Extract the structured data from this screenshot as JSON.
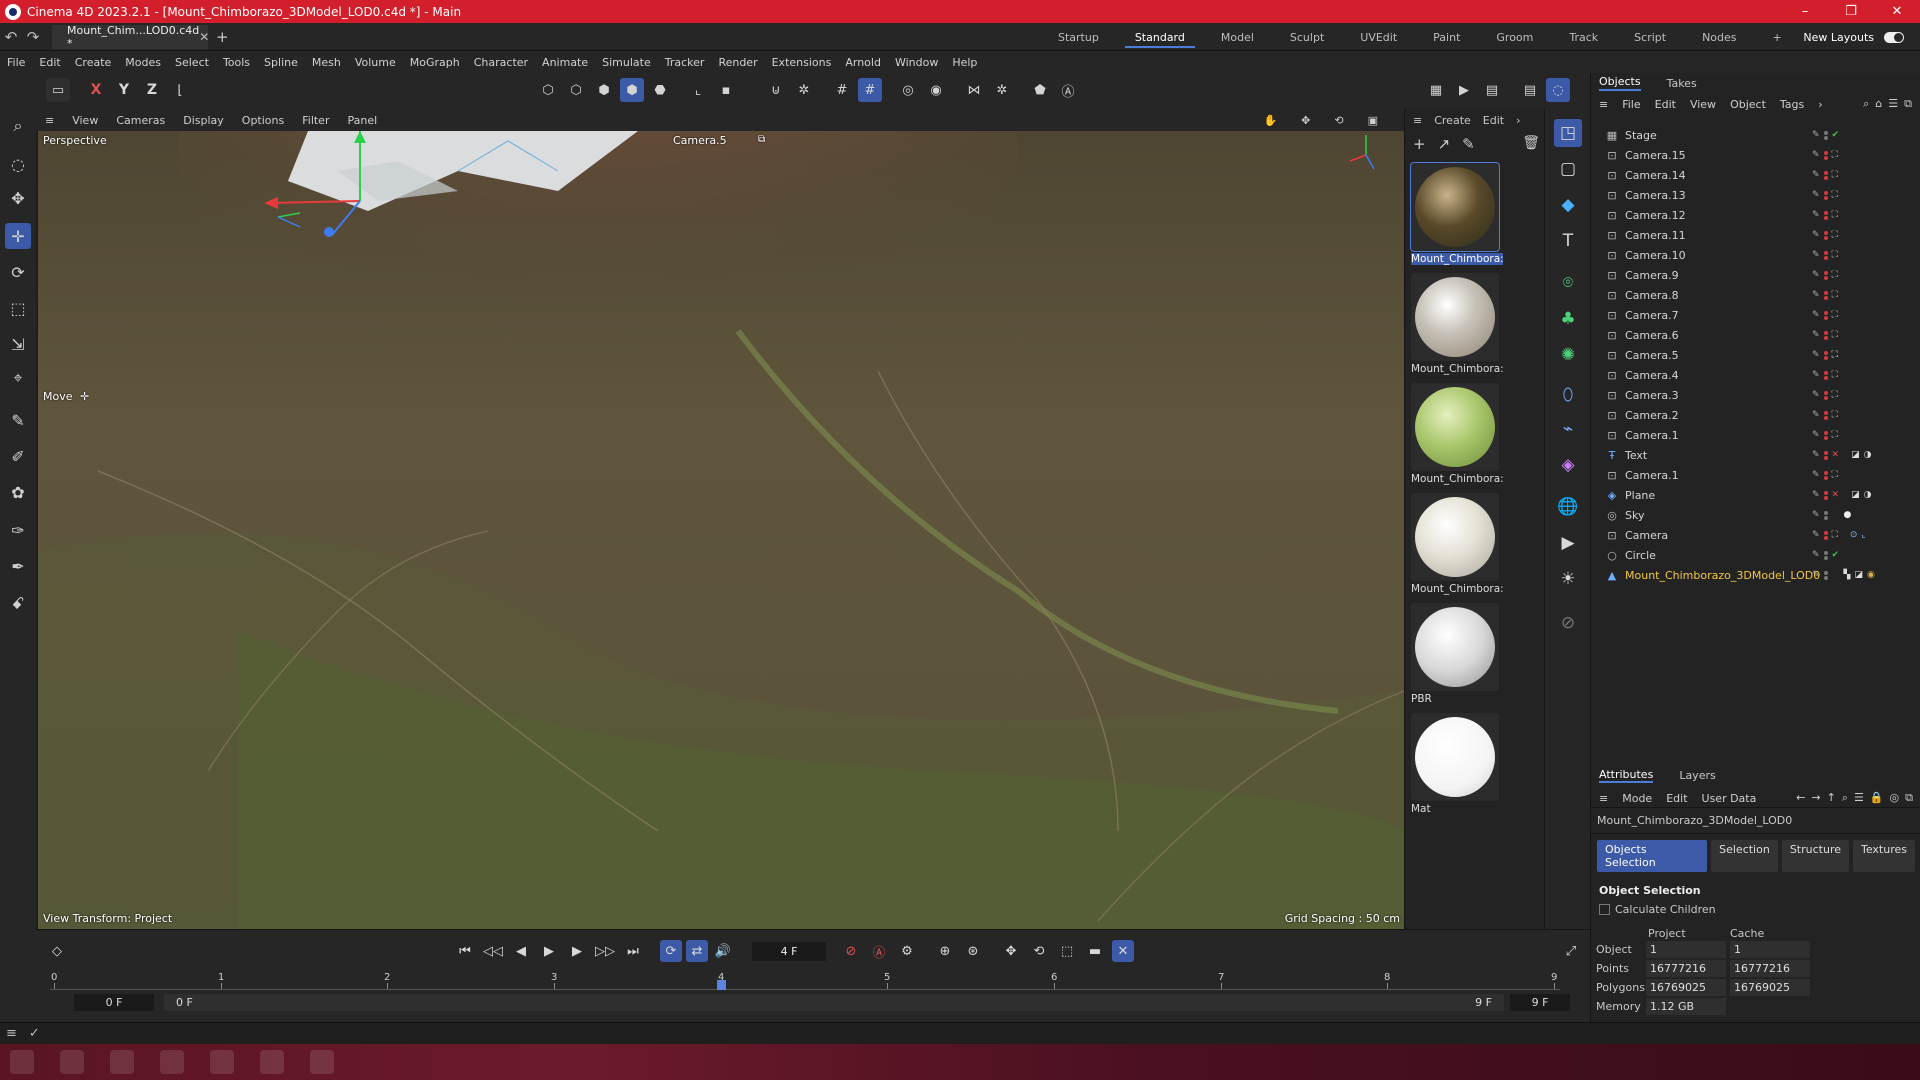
{
  "window": {
    "title": "Cinema 4D 2023.2.1 - [Mount_Chimborazo_3DModel_LOD0.c4d *] - Main",
    "min": "–",
    "max": "❐",
    "close": "✕"
  },
  "tabs": {
    "doc_tab": "Mount_Chim...LOD0.c4d *",
    "add": "+",
    "undo": "↶",
    "redo": "↷"
  },
  "layouts": [
    "Startup",
    "Standard",
    "Model",
    "Sculpt",
    "UVEdit",
    "Paint",
    "Groom",
    "Track",
    "Script",
    "Nodes"
  ],
  "layouts_add": "+",
  "new_layouts": "New Layouts",
  "menu": [
    "File",
    "Edit",
    "Create",
    "Modes",
    "Select",
    "Tools",
    "Spline",
    "Mesh",
    "Volume",
    "MoGraph",
    "Character",
    "Animate",
    "Simulate",
    "Tracker",
    "Render",
    "Extensions",
    "Arnold",
    "Window",
    "Help"
  ],
  "axis_toggles": {
    "x": "X",
    "y": "Y",
    "z": "Z"
  },
  "viewport": {
    "menu": [
      "View",
      "Cameras",
      "Display",
      "Options",
      "Filter",
      "Panel"
    ],
    "projection": "Perspective",
    "camera": "Camera.5",
    "tool": "Move",
    "view_transform": "View Transform: Project",
    "grid_spacing": "Grid Spacing : 50 cm"
  },
  "materials": {
    "menu": [
      "Create",
      "Edit"
    ],
    "items": [
      {
        "name": "Mount_Chimbora:"
      },
      {
        "name": "Mount_Chimbora:"
      },
      {
        "name": "Mount_Chimbora:"
      },
      {
        "name": "Mount_Chimbora:"
      },
      {
        "name": "PBR"
      },
      {
        "name": "Mat"
      }
    ]
  },
  "objects_panel": {
    "tabs": [
      "Objects",
      "Takes"
    ],
    "menu": [
      "File",
      "Edit",
      "View",
      "Object",
      "Tags"
    ],
    "items": [
      {
        "name": "Stage",
        "icon": "stage-icon"
      },
      {
        "name": "Camera.15",
        "icon": "camera-icon"
      },
      {
        "name": "Camera.14",
        "icon": "camera-icon"
      },
      {
        "name": "Camera.13",
        "icon": "camera-icon"
      },
      {
        "name": "Camera.12",
        "icon": "camera-icon"
      },
      {
        "name": "Camera.11",
        "icon": "camera-icon"
      },
      {
        "name": "Camera.10",
        "icon": "camera-icon"
      },
      {
        "name": "Camera.9",
        "icon": "camera-icon"
      },
      {
        "name": "Camera.8",
        "icon": "camera-icon"
      },
      {
        "name": "Camera.7",
        "icon": "camera-icon"
      },
      {
        "name": "Camera.6",
        "icon": "camera-icon"
      },
      {
        "name": "Camera.5",
        "icon": "camera-icon"
      },
      {
        "name": "Camera.4",
        "icon": "camera-icon"
      },
      {
        "name": "Camera.3",
        "icon": "camera-icon"
      },
      {
        "name": "Camera.2",
        "icon": "camera-icon"
      },
      {
        "name": "Camera.1",
        "icon": "camera-icon"
      },
      {
        "name": "Text",
        "icon": "text-icon"
      },
      {
        "name": "Camera.1",
        "icon": "camera-icon"
      },
      {
        "name": "Plane",
        "icon": "plane-icon"
      },
      {
        "name": "Sky",
        "icon": "sky-icon"
      },
      {
        "name": "Camera",
        "icon": "camera-icon"
      },
      {
        "name": "Circle",
        "icon": "circle-icon"
      },
      {
        "name": "Mount_Chimborazo_3DModel_LOD0",
        "icon": "polygon-icon"
      }
    ]
  },
  "attributes": {
    "tabs": [
      "Attributes",
      "Layers"
    ],
    "menu": [
      "Mode",
      "Edit",
      "User Data"
    ],
    "object_name": "Mount_Chimborazo_3DModel_LOD0",
    "buttons": [
      "Objects Selection",
      "Selection",
      "Structure",
      "Textures"
    ],
    "section": "Object Selection",
    "calc_children": "Calculate Children",
    "columns": [
      "Project",
      "Cache"
    ],
    "rows": [
      {
        "k": "Object",
        "project": "1",
        "cache": "1"
      },
      {
        "k": "Points",
        "project": "16777216",
        "cache": "16777216"
      },
      {
        "k": "Polygons",
        "project": "16769025",
        "cache": "16769025"
      },
      {
        "k": "Memory",
        "project": "1.12 GB",
        "cache": ""
      }
    ]
  },
  "timeline": {
    "current_frame": "4 F",
    "ticks": [
      "0",
      "1",
      "2",
      "3",
      "4",
      "5",
      "6",
      "7",
      "8",
      "9"
    ],
    "start": "0 F",
    "range_start": "0 F",
    "range_end": "9 F",
    "end": "9 F",
    "playhead_frame": 4,
    "frame_count": 9
  },
  "colors": {
    "accent": "#3d5aa8",
    "titlebar": "#d21f2b",
    "highlight_text": "#f2c744"
  }
}
